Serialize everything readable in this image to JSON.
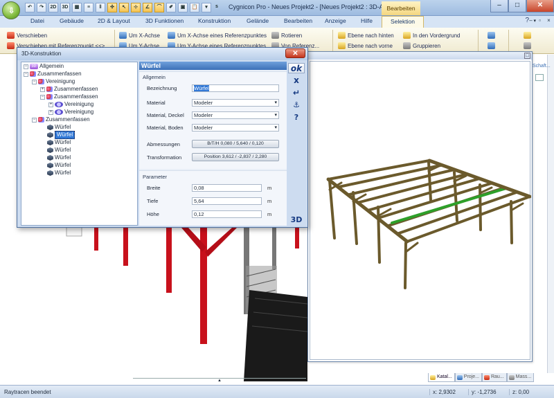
{
  "titlebar": {
    "title": "Cygnicon Pro - Neues Projekt2 - [Neues Projekt2 : 3D-Ansicht]",
    "context_tab": "Bearbeiten",
    "qat": [
      "2D",
      "3D"
    ],
    "qat_separator": "s",
    "window_controls": {
      "minimize": "–",
      "maximize": "□",
      "close": "✕"
    }
  },
  "ribbon": {
    "tabs": [
      "Datei",
      "Gebäude",
      "2D & Layout",
      "3D Funktionen",
      "Konstruktion",
      "Gelände",
      "Bearbeiten",
      "Anzeige",
      "Hilfe",
      "Selektion"
    ],
    "active_tab": "Selektion",
    "commands": {
      "verschieben": "Verschieben",
      "verschieben_ref": "Verschieben mit Referenzpunkt <<>",
      "um_x": "Um X-Achse",
      "um_y": "Um Y-Achse",
      "um_x_ref": "Um X-Achse eines Referenzpunktes",
      "um_y_ref": "Um Y-Achse eines Referenzpunktes",
      "rotieren": "Rotieren",
      "von_referenz": "Von Referenz...",
      "ebene_hinten": "Ebene nach hinten",
      "ebene_vorne": "Ebene nach vorne",
      "vordergrund": "In den Vordergrund",
      "gruppieren": "Gruppieren",
      "right_peek": "Schaft..."
    }
  },
  "dialog": {
    "title": "3D-Konstruktion",
    "close": "✕",
    "tree": [
      {
        "label": "Allgemein",
        "icon": "3d-icon",
        "badge": "3D"
      },
      {
        "label": "Zusammenfassen",
        "icon": "group-icon"
      },
      {
        "label": "Vereinigung",
        "icon": "group-icon"
      },
      {
        "label": "Zusammenfassen",
        "icon": "group-icon"
      },
      {
        "label": "Zusammenfassen",
        "icon": "group-icon"
      },
      {
        "label": "Vereinigung",
        "icon": "union-icon"
      },
      {
        "label": "Vereinigung",
        "icon": "union-icon"
      },
      {
        "label": "Zusammenfassen",
        "icon": "group-icon"
      },
      {
        "label": "Würfel",
        "icon": "cube-icon"
      },
      {
        "label": "Würfel",
        "icon": "cube-icon",
        "selected": true
      },
      {
        "label": "Würfel",
        "icon": "cube-icon"
      },
      {
        "label": "Würfel",
        "icon": "cube-icon"
      },
      {
        "label": "Würfel",
        "icon": "cube-icon"
      },
      {
        "label": "Würfel",
        "icon": "cube-icon"
      },
      {
        "label": "Würfel",
        "icon": "cube-icon"
      }
    ],
    "tree_expanders": [
      "−",
      "+"
    ],
    "props": {
      "header": "Würfel",
      "allgemein": {
        "title": "Allgemein",
        "bezeichnung_label": "Bezeichnung",
        "bezeichnung_value": "Würfel",
        "material_label": "Material",
        "material_value": "Modeler",
        "deckel_label": "Material, Deckel",
        "deckel_value": "Modeler",
        "boden_label": "Material, Boden",
        "boden_value": "Modeler",
        "abmessungen_label": "Abmessungen",
        "abmessungen_value": "B/T/H 0,080 / 5,640 / 0,120",
        "transformation_label": "Transformation",
        "transformation_value": "Position 3,612 / -2,837 / 2,280"
      },
      "parameter": {
        "title": "Parameter",
        "breite_label": "Breite",
        "breite_value": "0,08",
        "tiefe_label": "Tiefe",
        "tiefe_value": "5,64",
        "hoehe_label": "Höhe",
        "hoehe_value": "0,12",
        "unit": "m"
      }
    },
    "side_buttons": {
      "ok": "ok",
      "cancel": "x",
      "apply": "↵",
      "anchor": "⚓",
      "help": "?",
      "view3d": "3D"
    }
  },
  "view3d": {
    "close": "□"
  },
  "panel_tabs": [
    "Katal...",
    "Proje...",
    "Rau...",
    "Mass..."
  ],
  "splitter_glyph": "▲",
  "status": {
    "text": "Raytracen beendet",
    "x": "x: 2,9302",
    "y": "y: -1,2736",
    "z": "z: 0,00"
  },
  "colors": {
    "beam_wood": "#6b5a2c",
    "beam_highlight": "#2ea02a",
    "post_red": "#c8111c",
    "accent_blue": "#3178d6"
  }
}
